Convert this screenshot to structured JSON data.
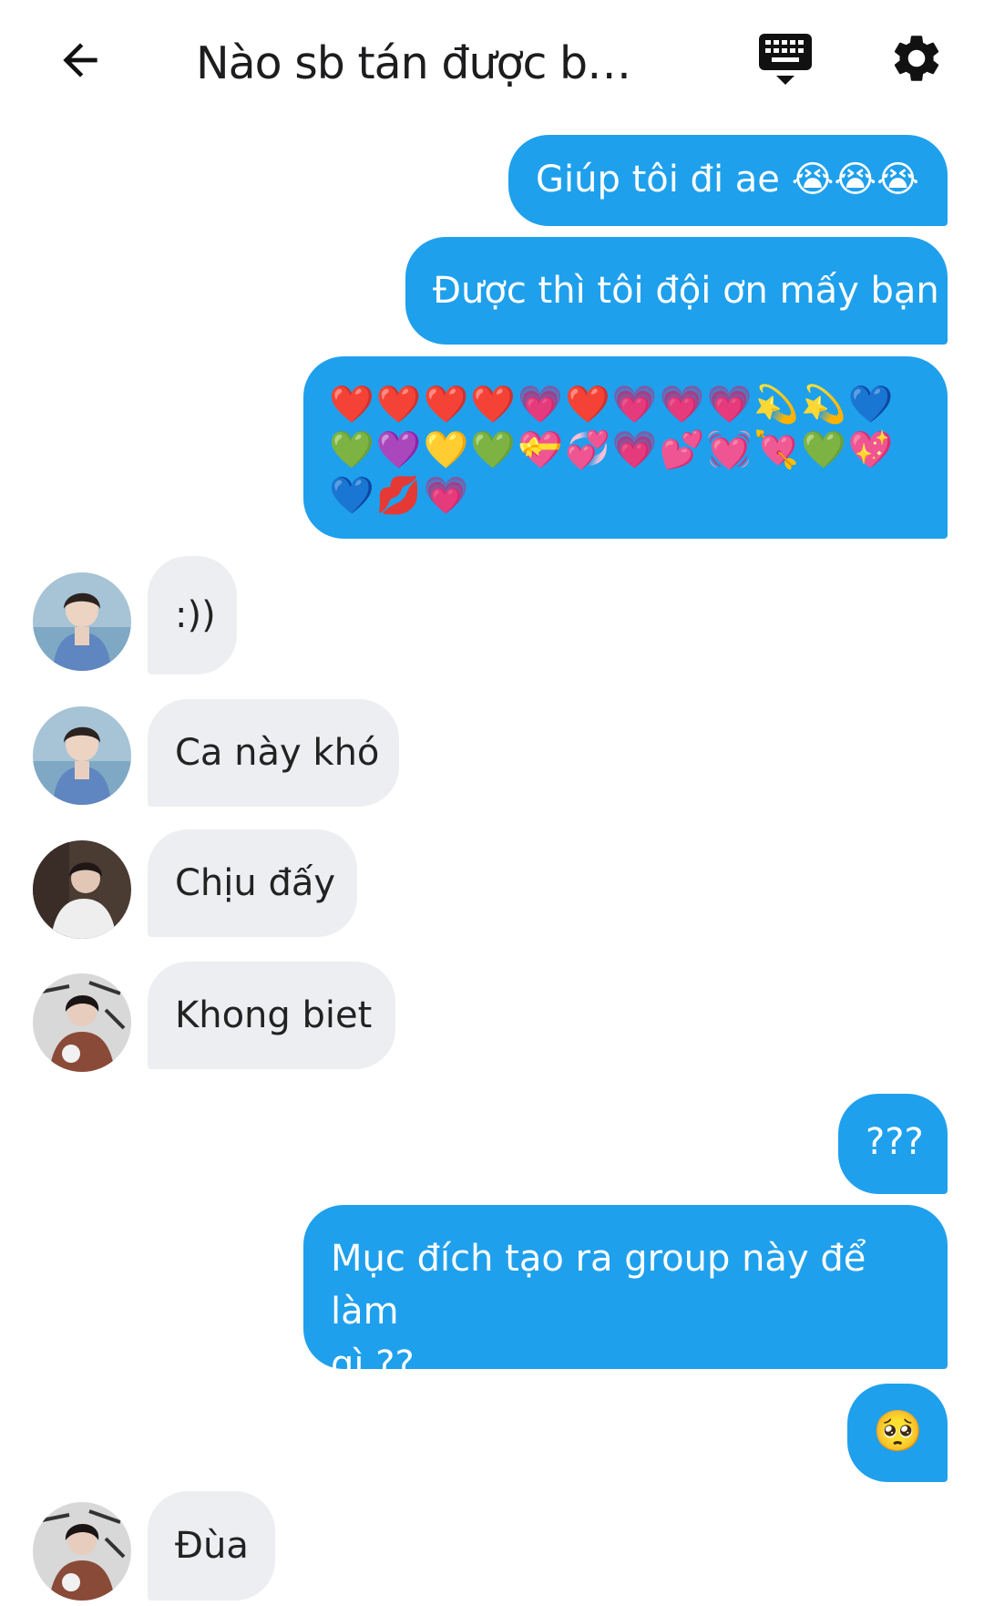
{
  "header": {
    "title": "Nào sb tán được bg t···",
    "back_icon": "arrow-left-icon",
    "keyboard_icon": "keyboard-icon",
    "settings_icon": "gear-icon"
  },
  "colors": {
    "outgoing_bubble": "#1fa0ec",
    "incoming_bubble": "#eceef1",
    "header_text": "#1d1d1f"
  },
  "messages": [
    {
      "dir": "out",
      "text": "Giúp tôi đi ae 😭😭😭"
    },
    {
      "dir": "out",
      "text": "Được thì tôi đội ơn mấy bạn"
    },
    {
      "dir": "out",
      "lines": [
        "❤️❤️❤️❤️💗❤️💗💗💗💫💫💙",
        "💚💜💛💚💝💞💗💕💓💘💚💖",
        "💙💋💗"
      ]
    },
    {
      "dir": "in",
      "text": ":))"
    },
    {
      "dir": "in",
      "text": "Ca này khó"
    },
    {
      "dir": "in",
      "text": "Chịu đấy"
    },
    {
      "dir": "in",
      "text": "Khong biet"
    },
    {
      "dir": "out",
      "text": "???"
    },
    {
      "dir": "out",
      "lines": [
        "Mục đích tạo ra group này để làm",
        "gì ??"
      ]
    },
    {
      "dir": "out",
      "text": "🥺"
    },
    {
      "dir": "in",
      "text": "Đùa"
    }
  ]
}
